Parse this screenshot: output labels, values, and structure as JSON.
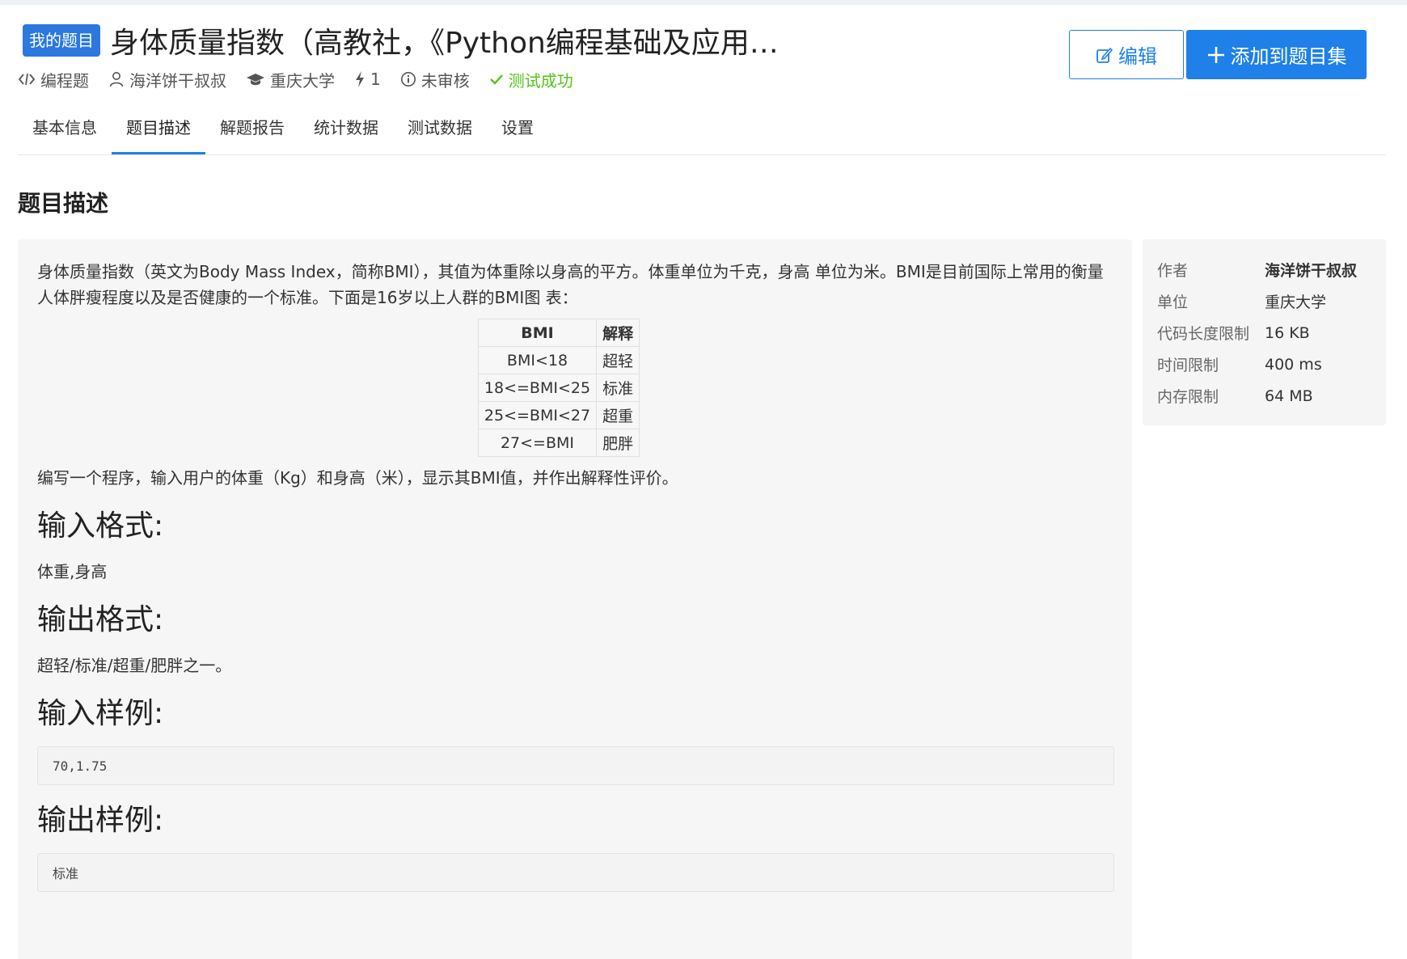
{
  "header": {
    "badge": "我的题目",
    "title": "身体质量指数（高教社，《Python编程基础及应用…",
    "edit_label": "编辑",
    "add_label": "添加到题目集"
  },
  "meta": {
    "type": "编程题",
    "author": "海洋饼干叔叔",
    "school": "重庆大学",
    "count": "1",
    "review": "未审核",
    "test": "测试成功"
  },
  "tabs": [
    "基本信息",
    "题目描述",
    "解题报告",
    "统计数据",
    "测试数据",
    "设置"
  ],
  "section_title": "题目描述",
  "description": {
    "intro": "身体质量指数（英文为Body Mass Index，简称BMI），其值为体重除以身高的平方。体重单位为千克，身高 单位为米。BMI是目前国际上常用的衡量人体胖瘦程度以及是否健康的一个标准。下面是16岁以上人群的BMI图 表：",
    "table": {
      "headers": [
        "BMI",
        "解释"
      ],
      "rows": [
        [
          "BMI<18",
          "超轻"
        ],
        [
          "18<=BMI<25",
          "标准"
        ],
        [
          "25<=BMI<27",
          "超重"
        ],
        [
          "27<=BMI",
          "肥胖"
        ]
      ]
    },
    "task": "编写一个程序，输入用户的体重（Kg）和身高（米），显示其BMI值，并作出解释性评价。",
    "input_heading": "输入格式:",
    "input_text": "体重,身高",
    "output_heading": "输出格式:",
    "output_text": "超轻/标准/超重/肥胖之一。",
    "sample_in_heading": "输入样例:",
    "sample_in": "70,1.75",
    "sample_out_heading": "输出样例:",
    "sample_out": "标准"
  },
  "side": {
    "rows": [
      {
        "k": "作者",
        "v": "海洋饼干叔叔"
      },
      {
        "k": "单位",
        "v": "重庆大学"
      },
      {
        "k": "代码长度限制",
        "v": "16 KB"
      },
      {
        "k": "时间限制",
        "v": "400 ms"
      },
      {
        "k": "内存限制",
        "v": "64 MB"
      }
    ]
  },
  "colors": {
    "accent": "#1e80e8",
    "success": "#52c41a"
  }
}
